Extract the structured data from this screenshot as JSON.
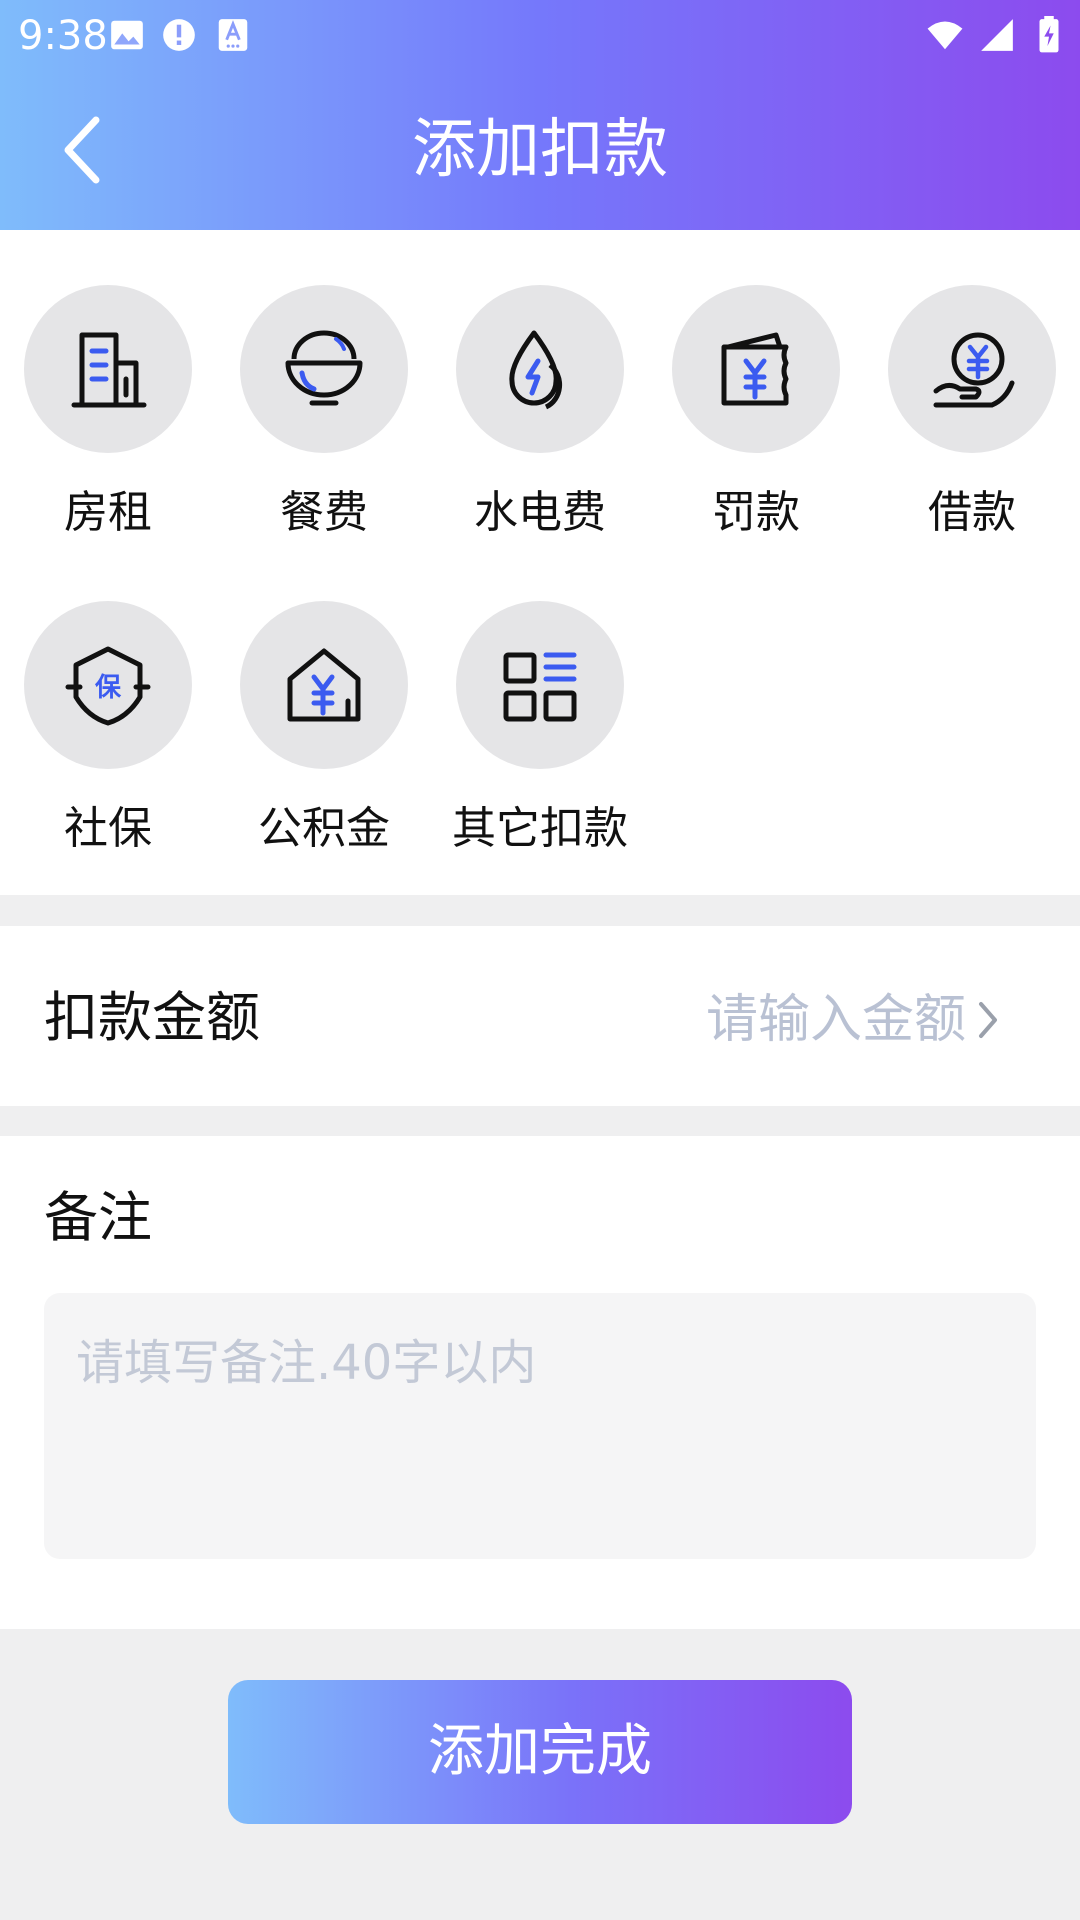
{
  "status_bar": {
    "time": "9:38",
    "left_icons": [
      "image-icon",
      "alert-icon",
      "font-icon"
    ],
    "right_icons": [
      "wifi-icon",
      "signal-icon",
      "battery-icon"
    ]
  },
  "header": {
    "title": "添加扣款",
    "back_icon": "chevron-left-icon",
    "gradient": [
      "#7fbcfb",
      "#7578fb",
      "#8c4bee"
    ]
  },
  "categories": [
    {
      "label": "房租",
      "icon": "building-icon"
    },
    {
      "label": "餐费",
      "icon": "rice-bowl-icon"
    },
    {
      "label": "水电费",
      "icon": "water-electricity-icon"
    },
    {
      "label": "罚款",
      "icon": "fine-ticket-icon"
    },
    {
      "label": "借款",
      "icon": "loan-hand-coin-icon"
    },
    {
      "label": "社保",
      "icon": "insurance-shield-icon"
    },
    {
      "label": "公积金",
      "icon": "housing-fund-icon"
    },
    {
      "label": "其它扣款",
      "icon": "other-grid-icon"
    }
  ],
  "amount": {
    "label": "扣款金额",
    "placeholder": "请输入金额"
  },
  "remark": {
    "label": "备注",
    "placeholder": "请填写备注.40字以内"
  },
  "submit": {
    "label": "添加完成"
  },
  "colors": {
    "accent_blue": "#3b5bf0",
    "placeholder_gray": "#b9c1d3",
    "page_background": "#efeff0"
  }
}
